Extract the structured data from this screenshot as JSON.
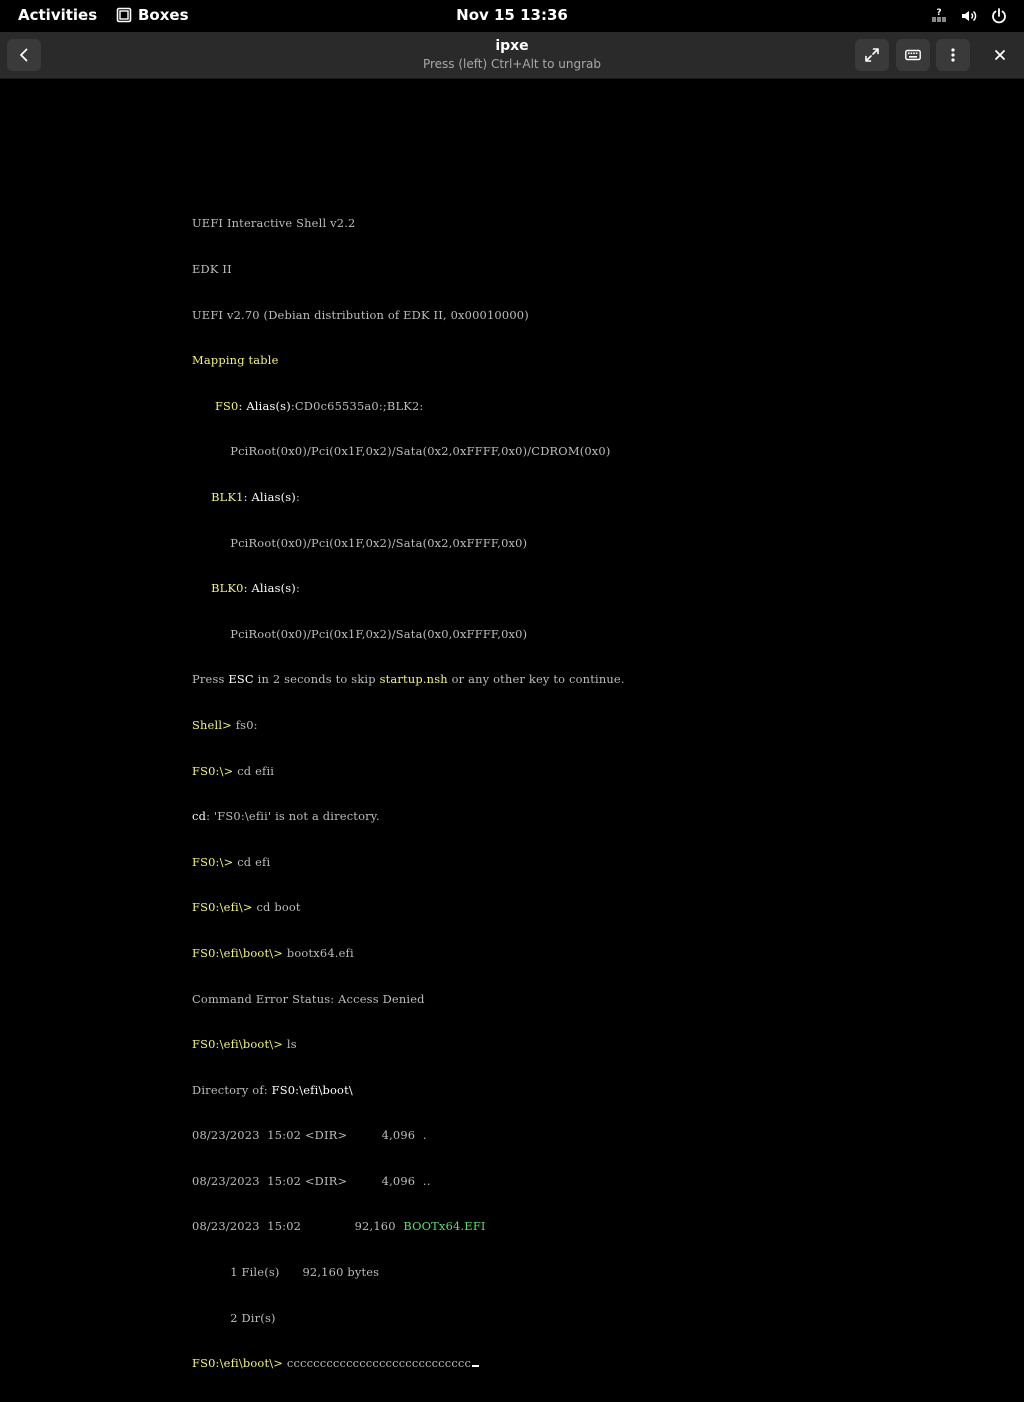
{
  "topbar": {
    "activities": "Activities",
    "app_name": "Boxes",
    "clock": "Nov 15  13:36"
  },
  "header": {
    "title": "ipxe",
    "subtitle": "Press (left) Ctrl+Alt to ungrab"
  },
  "terminal": {
    "l1": "UEFI Interactive Shell v2.2",
    "l2": "EDK II",
    "l3": "UEFI v2.70 (Debian distribution of EDK II, 0x00010000)",
    "l4": "Mapping table",
    "l5_indent": "      ",
    "l5_dev": "FS0",
    "l5_mid": ": Alias(s)",
    "l5_rest": ":CD0c65535a0:;BLK2:",
    "l6": "          PciRoot(0x0)/Pci(0x1F,0x2)/Sata(0x2,0xFFFF,0x0)/CDROM(0x0)",
    "l7_indent": "     ",
    "l7_dev": "BLK1",
    "l7_mid": ": Alias(s)",
    "l7_rest": ":",
    "l8": "          PciRoot(0x0)/Pci(0x1F,0x2)/Sata(0x2,0xFFFF,0x0)",
    "l9_indent": "     ",
    "l9_dev": "BLK0",
    "l9_mid": ": Alias(s)",
    "l9_rest": ":",
    "l10": "          PciRoot(0x0)/Pci(0x1F,0x2)/Sata(0x0,0xFFFF,0x0)",
    "l11_a": "Press ",
    "l11_esc": "ESC",
    "l11_b": " in 2 seconds to skip ",
    "l11_file": "startup.nsh",
    "l11_c": " or any other key to continue.",
    "l12_prompt": "Shell> ",
    "l12_cmd": "fs0:",
    "l13_prompt": "FS0:\\> ",
    "l13_cmd": "cd efii",
    "l14_cd": "cd",
    "l14_rest": ": 'FS0:\\efii' is not a directory.",
    "l15_prompt": "FS0:\\> ",
    "l15_cmd": "cd efi",
    "l16_prompt": "FS0:\\efi\\> ",
    "l16_cmd": "cd boot",
    "l17_prompt": "FS0:\\efi\\boot\\> ",
    "l17_cmd": "bootx64.efi",
    "l18": "Command Error Status: Access Denied",
    "l19_prompt": "FS0:\\efi\\boot\\> ",
    "l19_cmd": "ls",
    "l20_label": "Directory of: ",
    "l20_path": "FS0:\\efi\\boot\\",
    "l21": "08/23/2023  15:02 <DIR>         4,096  .",
    "l22": "08/23/2023  15:02 <DIR>         4,096  ..",
    "l23_a": "08/23/2023  15:02              92,160  ",
    "l23_file": "BOOTx64.EFI",
    "l24": "          1 File(s)      92,160 bytes",
    "l25": "          2 Dir(s)",
    "l26_prompt": "FS0:\\efi\\boot\\> ",
    "l26_cmd": "cccccccccccccccccccccccccccc"
  }
}
